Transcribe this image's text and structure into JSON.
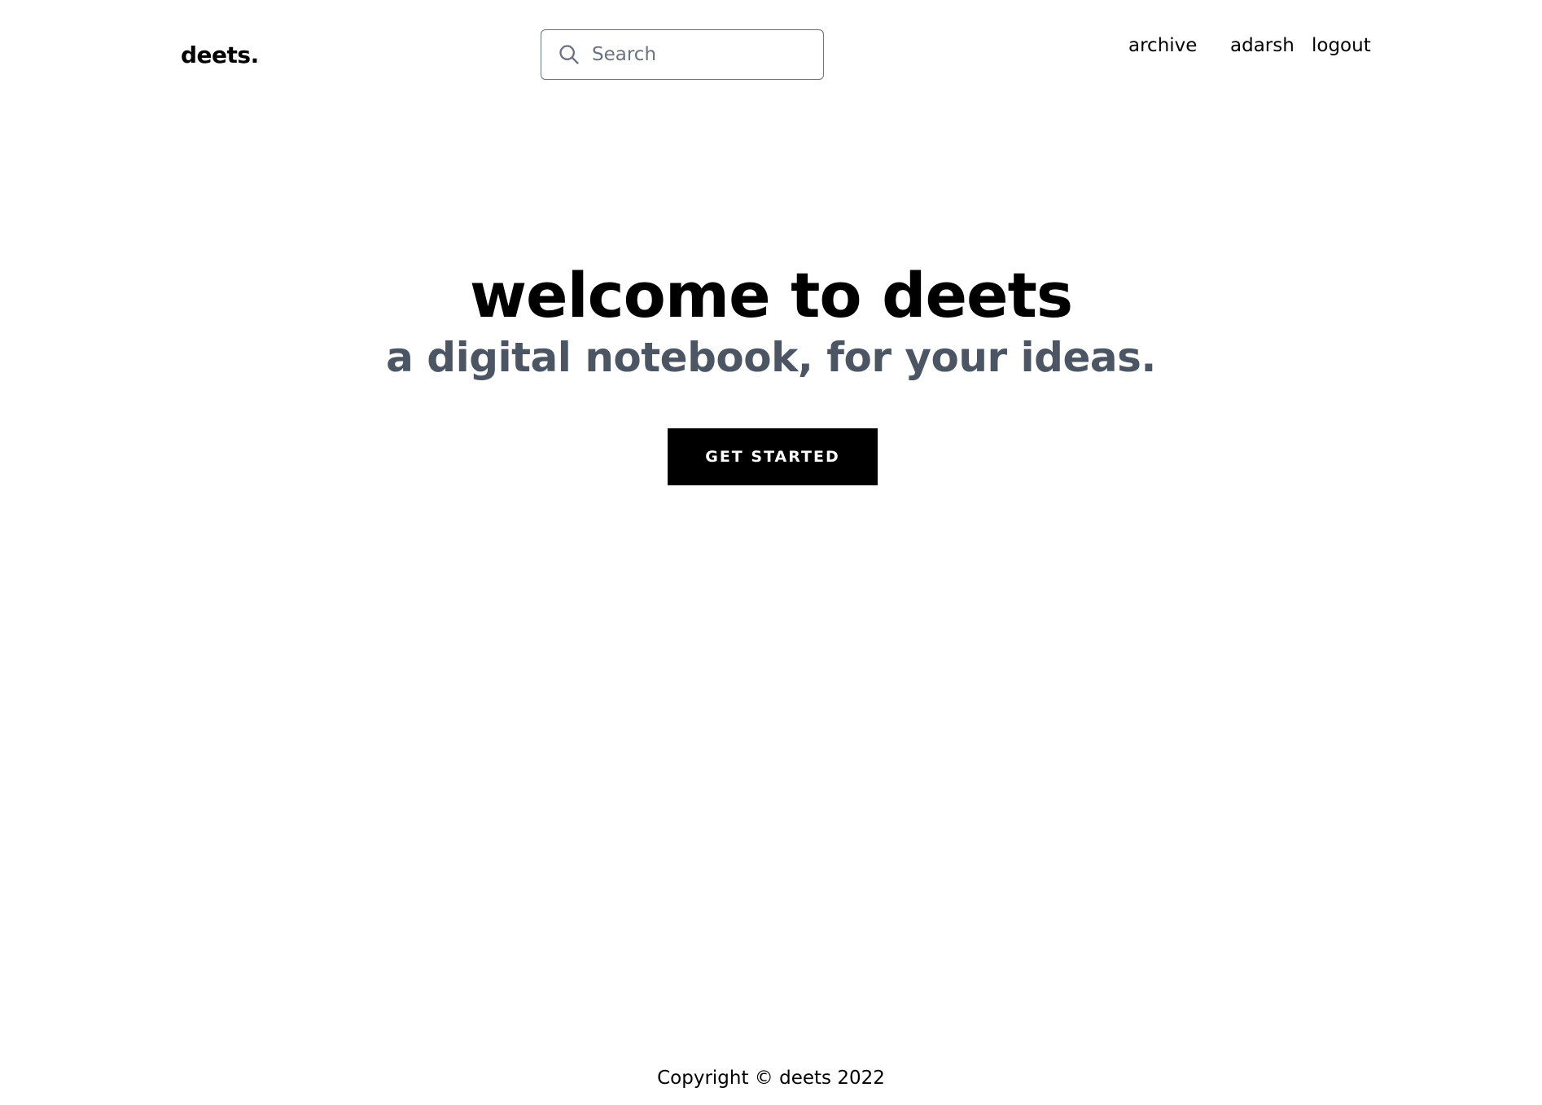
{
  "header": {
    "logo": "deets.",
    "search": {
      "placeholder": "Search",
      "value": "",
      "icon": "search-icon"
    },
    "nav": {
      "archive": "archive",
      "user": "adarsh",
      "logout": "logout"
    }
  },
  "hero": {
    "title": "welcome to deets",
    "subtitle": "a digital notebook, for your ideas.",
    "cta_label": "GET STARTED"
  },
  "footer": {
    "copyright": "Copyright © deets 2022"
  },
  "colors": {
    "text": "#000000",
    "subtitle": "#4b5563",
    "button_bg": "#000000",
    "button_text": "#ffffff",
    "border": "#6b7280"
  }
}
